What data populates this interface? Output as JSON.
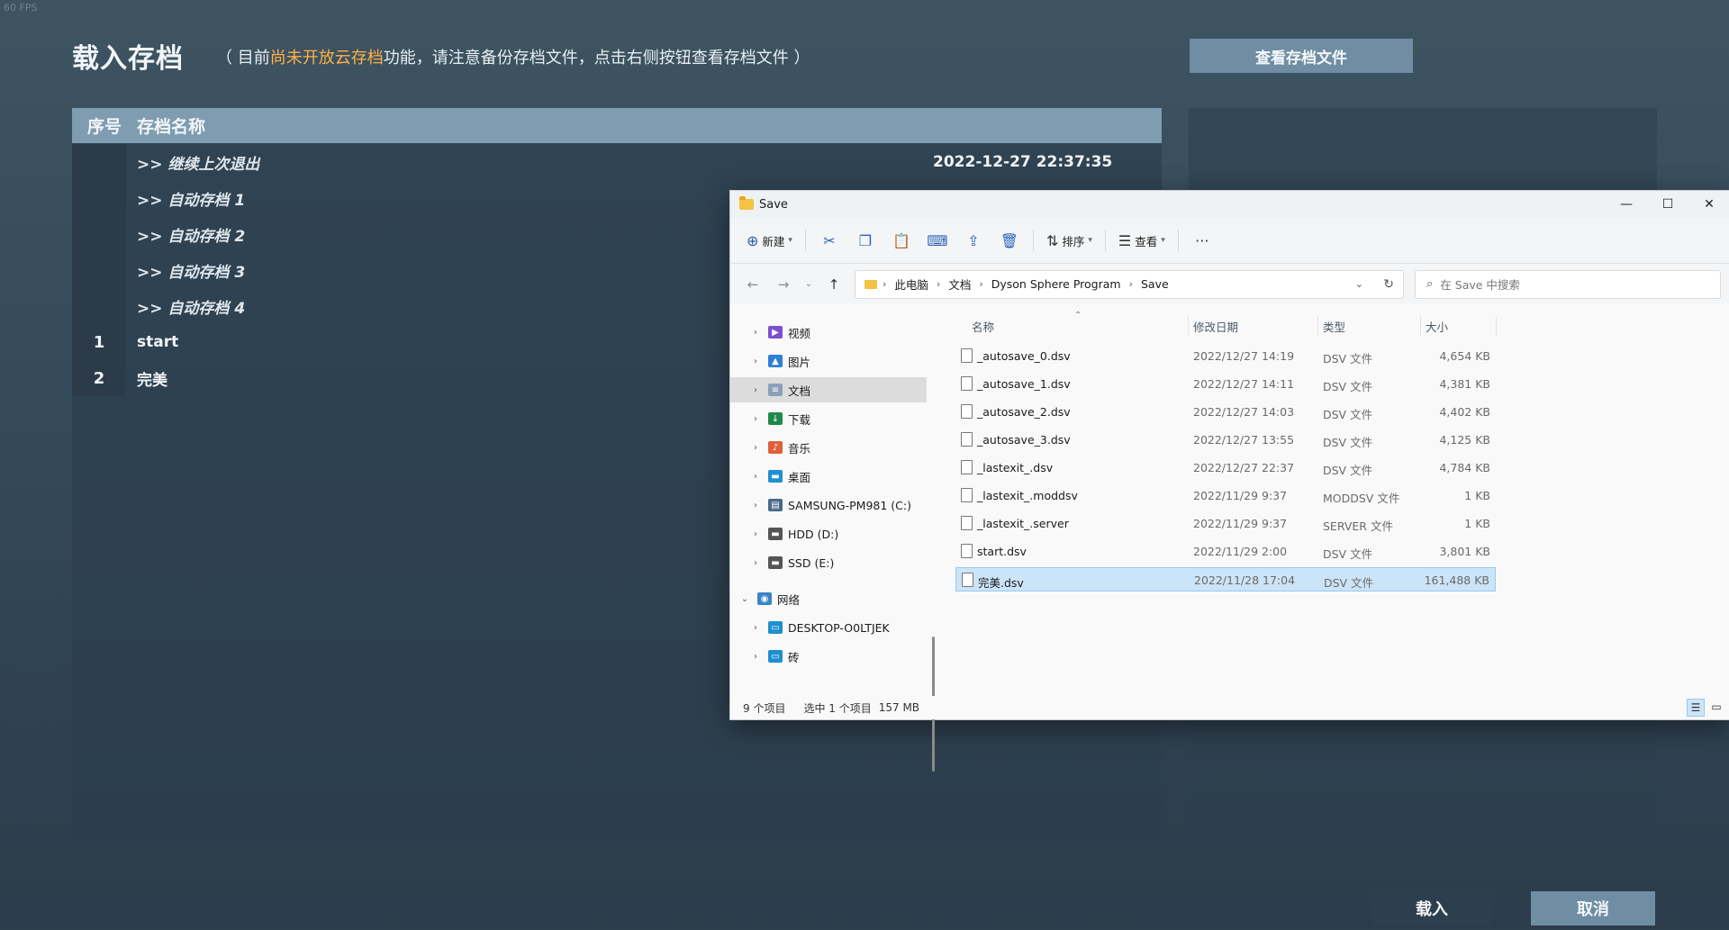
{
  "fps": "60 FPS",
  "header": {
    "title": "载入存档",
    "notice_prefix": "（ 目前",
    "notice_highlight": "尚未开放云存档",
    "notice_suffix": "功能，请注意备份存档文件，点击右侧按钮查看存档文件 ）",
    "view_files_button": "查看存档文件"
  },
  "save_list": {
    "col_no": "序号",
    "col_name": "存档名称",
    "rows": [
      {
        "no": "",
        "name": ">> 继续上次退出",
        "time": "2022-12-27 22:37:35",
        "auto": true
      },
      {
        "no": "",
        "name": ">> 自动存档 1",
        "time": "",
        "auto": true
      },
      {
        "no": "",
        "name": ">> 自动存档 2",
        "time": "",
        "auto": true
      },
      {
        "no": "",
        "name": ">> 自动存档 3",
        "time": "",
        "auto": true
      },
      {
        "no": "",
        "name": ">> 自动存档 4",
        "time": "",
        "auto": true
      },
      {
        "no": "1",
        "name": "start",
        "time": "",
        "auto": false
      },
      {
        "no": "2",
        "name": "完美",
        "time": "",
        "auto": false
      }
    ]
  },
  "footer": {
    "load_button": "载入",
    "cancel_button": "取消"
  },
  "explorer": {
    "title": "Save",
    "controls": {
      "minimize": "—",
      "maximize": "☐",
      "close": "✕"
    },
    "cmdbar": {
      "new_label": "新建",
      "sort_label": "排序",
      "view_label": "查看",
      "more": "···"
    },
    "breadcrumb": [
      "此电脑",
      "文档",
      "Dyson Sphere Program",
      "Save"
    ],
    "search_placeholder": "在 Save 中搜索",
    "nav_items": [
      {
        "label": "视频",
        "icon": "video-icon",
        "color": "#7b4fd1",
        "expanded": false,
        "selected": false
      },
      {
        "label": "图片",
        "icon": "pictures-icon",
        "color": "#2f7fd6",
        "expanded": false,
        "selected": false
      },
      {
        "label": "文档",
        "icon": "documents-icon",
        "color": "#8aa0b8",
        "expanded": false,
        "selected": true
      },
      {
        "label": "下载",
        "icon": "download-icon",
        "color": "#1f8a4c",
        "expanded": false,
        "selected": false
      },
      {
        "label": "音乐",
        "icon": "music-icon",
        "color": "#e0603a",
        "expanded": false,
        "selected": false
      },
      {
        "label": "桌面",
        "icon": "desktop-icon",
        "color": "#1f8fd0",
        "expanded": false,
        "selected": false
      },
      {
        "label": "SAMSUNG-PM981 (C:)",
        "icon": "drive-c-icon",
        "color": "#4a6a8a",
        "expanded": false,
        "selected": false
      },
      {
        "label": "HDD (D:)",
        "icon": "drive-icon",
        "color": "#555555",
        "expanded": false,
        "selected": false
      },
      {
        "label": "SSD (E:)",
        "icon": "drive-icon",
        "color": "#555555",
        "expanded": false,
        "selected": false
      },
      {
        "label": "网络",
        "icon": "network-icon",
        "color": "#3c83c9",
        "expanded": true,
        "selected": false
      },
      {
        "label": "DESKTOP-O0LTJEK",
        "icon": "computer-icon",
        "color": "#1f8fd0",
        "expanded": false,
        "selected": false
      },
      {
        "label": "砖",
        "icon": "computer-icon",
        "color": "#1f8fd0",
        "expanded": false,
        "selected": false
      }
    ],
    "columns": {
      "name": "名称",
      "date": "修改日期",
      "type": "类型",
      "size": "大小"
    },
    "files": [
      {
        "name": "_autosave_0.dsv",
        "date": "2022/12/27 14:19",
        "type": "DSV 文件",
        "size": "4,654 KB"
      },
      {
        "name": "_autosave_1.dsv",
        "date": "2022/12/27 14:11",
        "type": "DSV 文件",
        "size": "4,381 KB"
      },
      {
        "name": "_autosave_2.dsv",
        "date": "2022/12/27 14:03",
        "type": "DSV 文件",
        "size": "4,402 KB"
      },
      {
        "name": "_autosave_3.dsv",
        "date": "2022/12/27 13:55",
        "type": "DSV 文件",
        "size": "4,125 KB"
      },
      {
        "name": "_lastexit_.dsv",
        "date": "2022/12/27 22:37",
        "type": "DSV 文件",
        "size": "4,784 KB"
      },
      {
        "name": "_lastexit_.moddsv",
        "date": "2022/11/29 9:37",
        "type": "MODDSV 文件",
        "size": "1 KB"
      },
      {
        "name": "_lastexit_.server",
        "date": "2022/11/29 9:37",
        "type": "SERVER 文件",
        "size": "1 KB"
      },
      {
        "name": "start.dsv",
        "date": "2022/11/29 2:00",
        "type": "DSV 文件",
        "size": "3,801 KB"
      },
      {
        "name": "完美.dsv",
        "date": "2022/11/28 17:04",
        "type": "DSV 文件",
        "size": "161,488 KB"
      }
    ],
    "selected_file_index": 8,
    "status": {
      "count": "9 个项目",
      "selected": "选中 1 个项目",
      "size": "157 MB"
    }
  }
}
